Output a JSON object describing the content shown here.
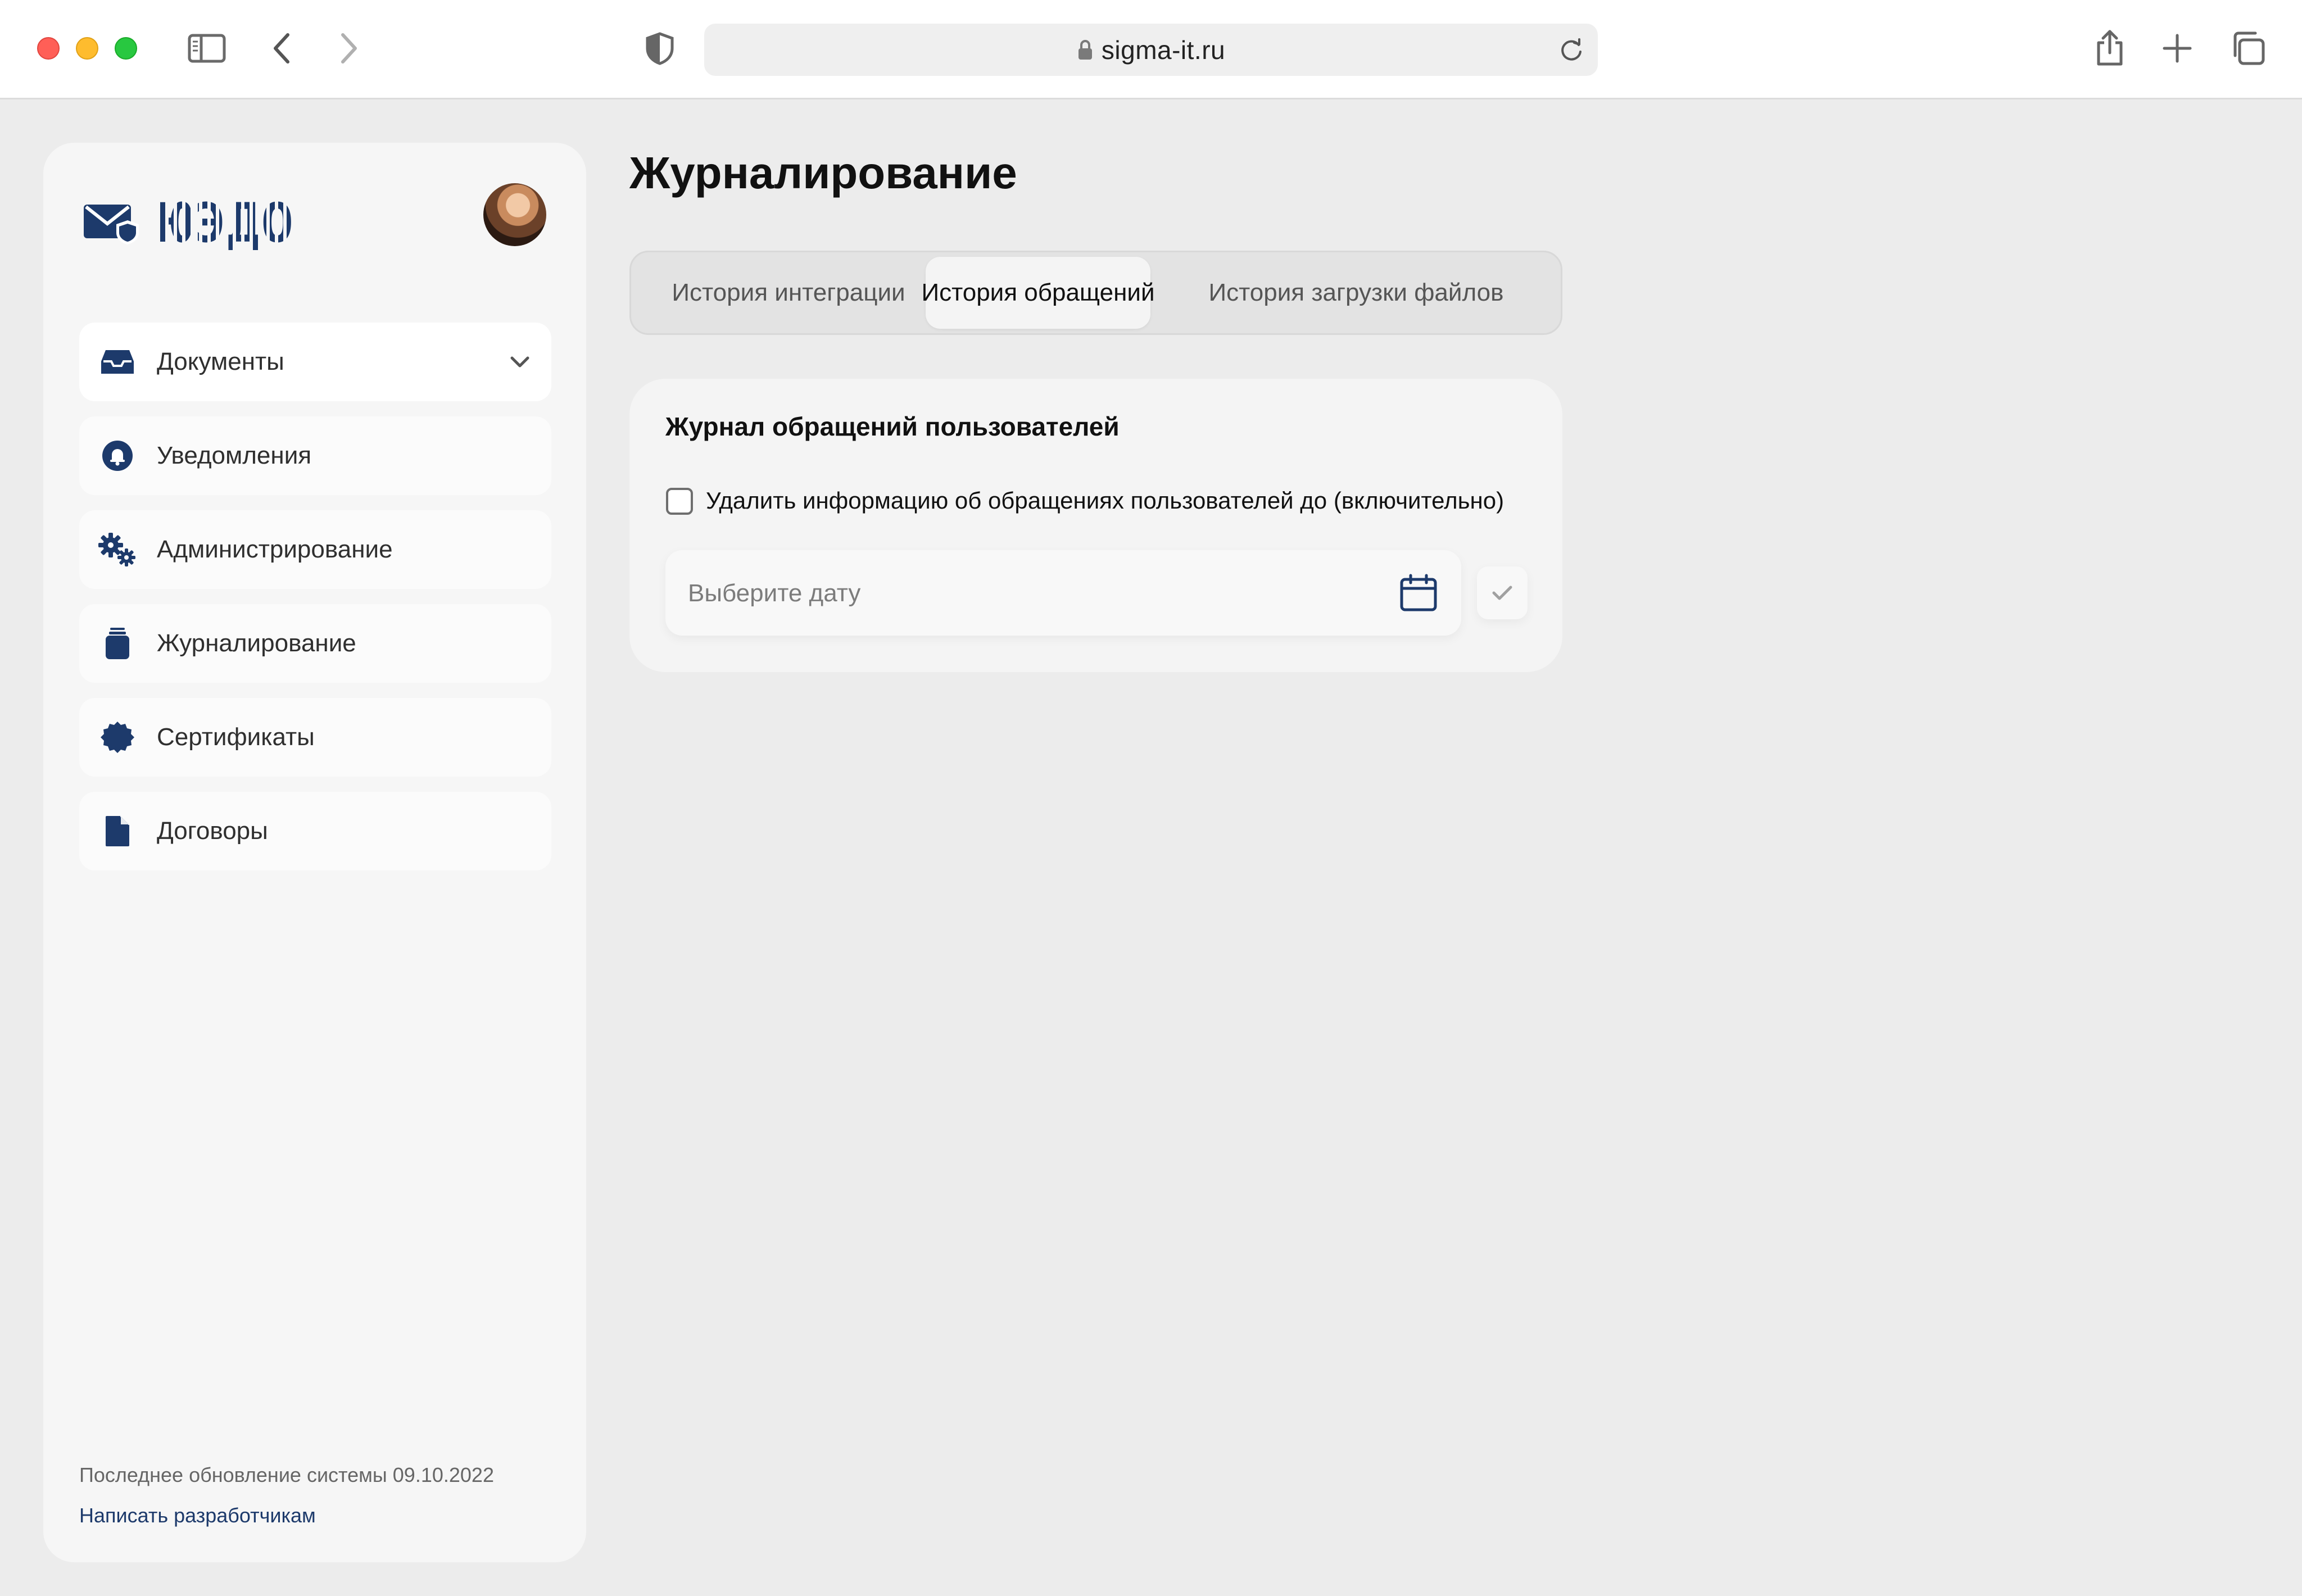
{
  "browser": {
    "url": "sigma-it.ru"
  },
  "sidebar": {
    "logo_text": "ЮЭДО",
    "items": [
      {
        "label": "Документы",
        "icon": "inbox-tray-icon"
      },
      {
        "label": "Уведомления",
        "icon": "bell-icon"
      },
      {
        "label": "Администрирование",
        "icon": "gears-icon"
      },
      {
        "label": "Журналирование",
        "icon": "jar-icon"
      },
      {
        "label": "Сертификаты",
        "icon": "badge-icon"
      },
      {
        "label": "Договоры",
        "icon": "file-icon"
      }
    ],
    "last_update": "Последнее обновление системы 09.10.2022",
    "dev_link": "Написать разработчикам"
  },
  "main": {
    "title": "Журналирование",
    "tabs": [
      {
        "label": "История интеграции",
        "active": false
      },
      {
        "label": "История обращений",
        "active": true
      },
      {
        "label": "История загрузки файлов",
        "active": false
      }
    ],
    "card": {
      "title": "Журнал обращений пользователей",
      "checkbox_label": "Удалить информацию об обращениях пользователей до (включительно)",
      "checkbox_checked": false,
      "date_placeholder": "Выберите дату"
    }
  },
  "colors": {
    "accent": "#1d3a6b",
    "background": "#ececec"
  }
}
